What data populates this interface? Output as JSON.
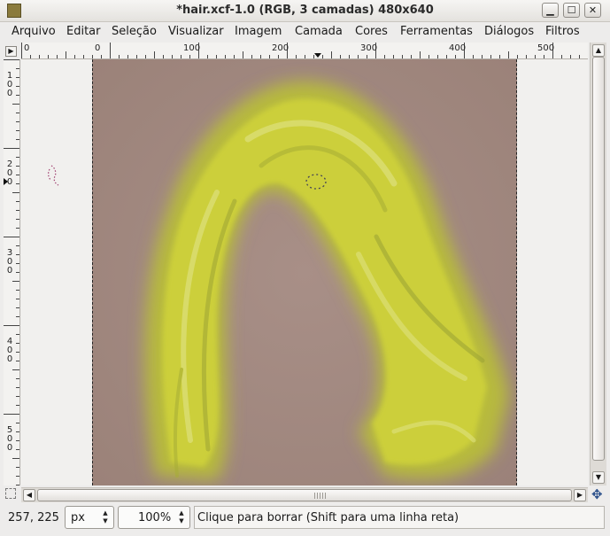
{
  "window": {
    "title": "*hair.xcf-1.0 (RGB, 3 camadas) 480x640",
    "buttons": {
      "minimize": "▁",
      "maximize": "☐",
      "close": "✕"
    }
  },
  "menu": {
    "items": [
      {
        "label": "Arquivo",
        "mnemonic": "A"
      },
      {
        "label": "Editar",
        "mnemonic": "E"
      },
      {
        "label": "Seleção",
        "mnemonic": "S"
      },
      {
        "label": "Visualizar",
        "mnemonic": "V"
      },
      {
        "label": "Imagem",
        "mnemonic": "I"
      },
      {
        "label": "Camada",
        "mnemonic": "C"
      },
      {
        "label": "Cores",
        "mnemonic": "C"
      },
      {
        "label": "Ferramentas",
        "mnemonic": "F"
      },
      {
        "label": "Diálogos",
        "mnemonic": "D"
      },
      {
        "label": "Filtros",
        "mnemonic": "i"
      }
    ]
  },
  "ruler": {
    "horizontal": [
      "0",
      "0",
      "100",
      "200",
      "300",
      "400",
      "500"
    ],
    "vertical": [
      "100",
      "200",
      "300",
      "400",
      "500"
    ]
  },
  "canvas": {
    "image_background": "#a88d86",
    "hair_colors": [
      "#cfd23a",
      "#b9bf3c",
      "#e1e486",
      "#9aa234"
    ]
  },
  "status": {
    "coords": "257, 225",
    "unit": "px",
    "zoom": "100%",
    "message": "Clique para borrar (Shift para uma linha reta)"
  }
}
